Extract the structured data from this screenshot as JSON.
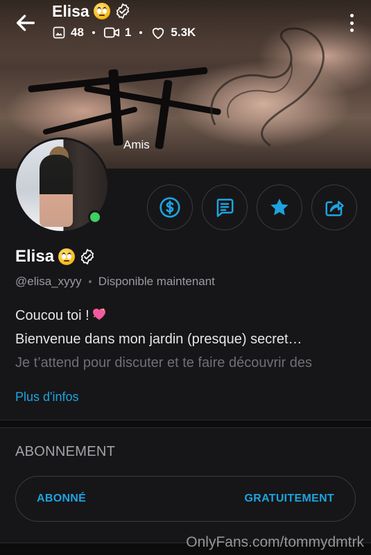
{
  "header": {
    "name": "Elisa",
    "stats": {
      "photos": "48",
      "videos": "1",
      "likes": "5.3K"
    },
    "icons": {
      "back": "back-arrow-icon",
      "more": "more-vert-icon",
      "photos": "image-icon",
      "videos": "video-icon",
      "likes": "heart-outline-icon"
    }
  },
  "banner_overlay_label": "Amis",
  "profile": {
    "name": "Elisa",
    "handle": "@elisa_xyyy",
    "status": "Disponible maintenant",
    "online": true
  },
  "actions": [
    {
      "name": "tip",
      "icon": "dollar-circle-icon"
    },
    {
      "name": "message",
      "icon": "chat-icon"
    },
    {
      "name": "favorite",
      "icon": "star-icon"
    },
    {
      "name": "share",
      "icon": "share-icon"
    }
  ],
  "bio": {
    "line1": "Coucou toi !",
    "line2": "Bienvenue dans mon jardin (presque) secret…",
    "line3": "Je t’attend pour discuter et te faire découvrir des"
  },
  "more_info_link": "Plus d'infos",
  "subscription": {
    "section_title": "ABONNEMENT",
    "button_left": "ABONNÉ",
    "button_right": "GRATUITEMENT"
  },
  "watermark": "OnlyFans.com/tommydmtrk",
  "colors": {
    "accent": "#1ea3e0",
    "background": "#161618",
    "online": "#3fcf63"
  }
}
